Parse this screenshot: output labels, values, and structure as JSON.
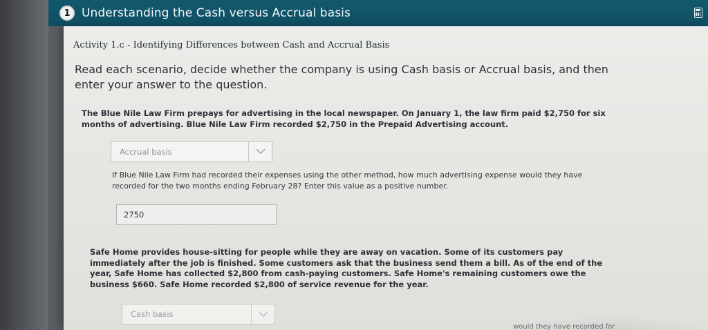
{
  "header": {
    "step_number": "1",
    "title": "Understanding the Cash versus Accrual basis"
  },
  "activity": {
    "title": "Activity 1.c - Identifying Differences between Cash and Accrual Basis",
    "instruction": "Read each scenario, decide whether the company is using Cash basis or Accrual basis, and then enter your answer to the question."
  },
  "scenarios": [
    {
      "text": "The Blue Nile Law Firm prepays for advertising in the local newspaper. On January 1, the law firm paid $2,750 for six months of advertising. Blue Nile Law Firm recorded $2,750 in the Prepaid Advertising account.",
      "basis_selected": "Accrual basis",
      "question": "If Blue Nile Law Firm had recorded their expenses using the other method, how much advertising expense would they have recorded for the two months ending February 28? Enter this value as a positive number.",
      "answer": "2750"
    },
    {
      "text": "Safe Home provides house-sitting for people while they are away on vacation. Some of its customers pay immediately after the job is finished. Some customers ask that the business send them a bill. As of the end of the year, Safe Home has collected $2,800 from cash-paying customers. Safe Home's remaining customers owe the business $660. Safe Home recorded $2,800 of service revenue for the year.",
      "basis_selected": "Cash basis",
      "question_partial": "would they have recorded for"
    }
  ],
  "colors": {
    "header_bg": "#12596e",
    "panel_bg": "#e8e8e6"
  },
  "icons": {
    "calculator": "calculator-icon",
    "dropdown": "chevron-down-icon"
  }
}
